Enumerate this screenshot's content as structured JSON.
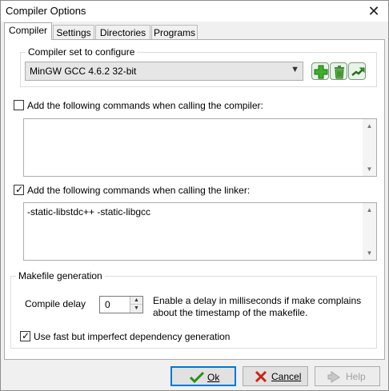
{
  "window": {
    "title": "Compiler Options"
  },
  "tabs": [
    {
      "label": "Compiler",
      "active": true
    },
    {
      "label": "Settings",
      "active": false
    },
    {
      "label": "Directories",
      "active": false
    },
    {
      "label": "Programs",
      "active": false
    }
  ],
  "compiler_set": {
    "title": "Compiler set to configure",
    "selected": "MinGW GCC 4.6.2 32-bit",
    "icons": [
      "add-icon",
      "delete-icon",
      "rename-icon"
    ]
  },
  "compiler_commands": {
    "checked": false,
    "label": "Add the following commands when calling the compiler:",
    "value": ""
  },
  "linker_commands": {
    "checked": true,
    "label": "Add the following commands when calling the linker:",
    "value": "-static-libstdc++ -static-libgcc"
  },
  "makefile": {
    "title": "Makefile generation",
    "delay_label": "Compile delay",
    "delay_value": "0",
    "delay_description": "Enable a delay in milliseconds if make complains about the timestamp of the makefile.",
    "fast_dep_checked": true,
    "fast_dep_label": "Use fast but imperfect dependency generation"
  },
  "buttons": {
    "ok": "Ok",
    "cancel": "Cancel",
    "help": "Help"
  },
  "colors": {
    "accent": "#0078d7",
    "add_green": "#3fae2a",
    "cancel_red": "#c8241a"
  }
}
